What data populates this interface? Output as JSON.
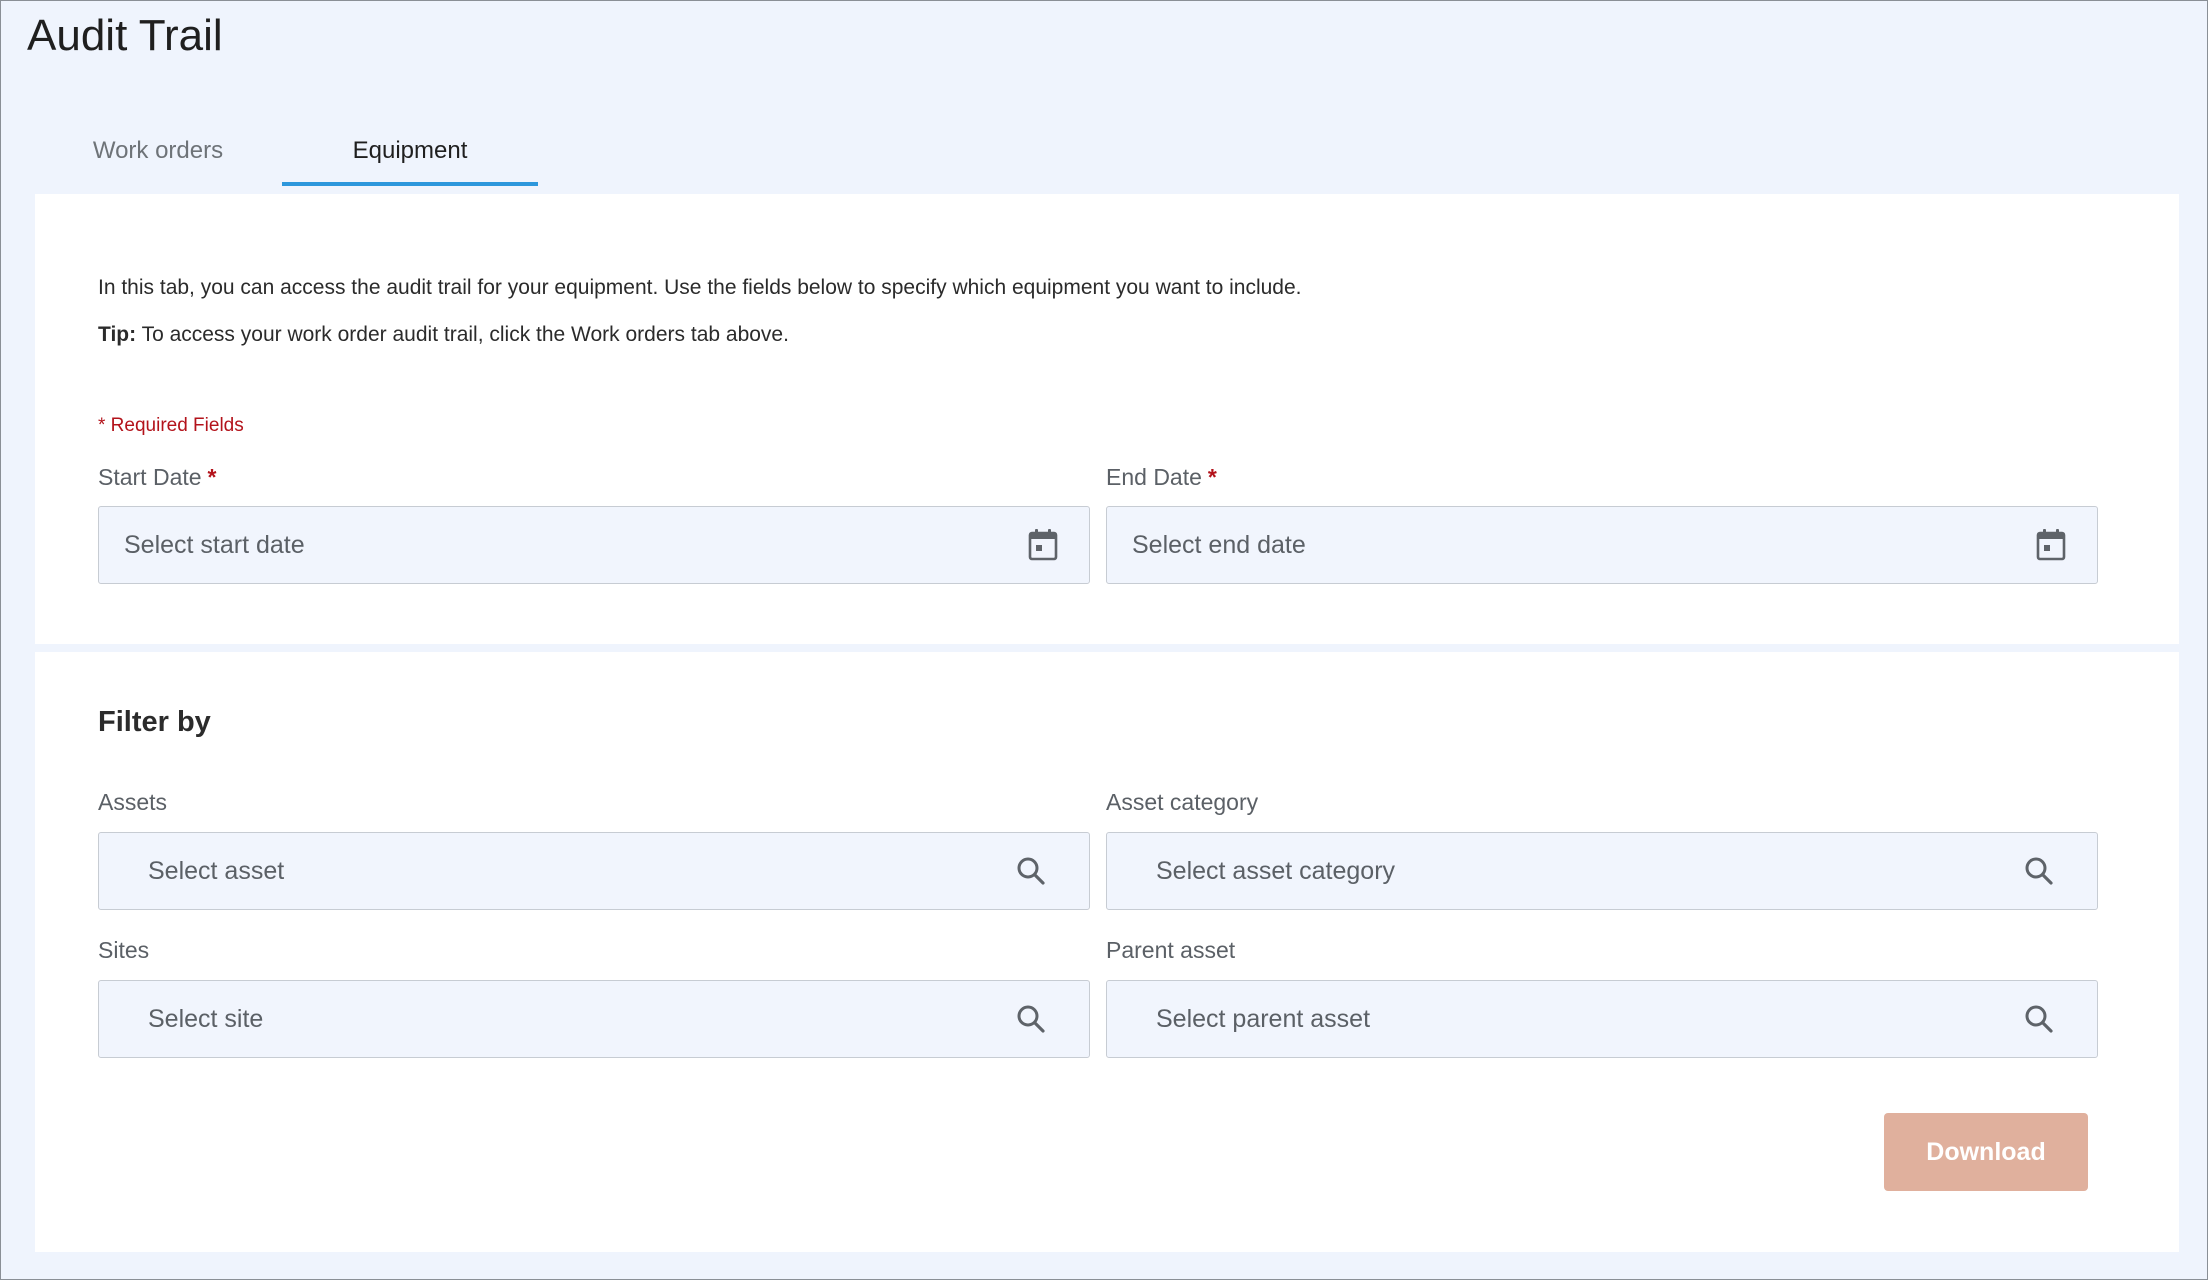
{
  "page": {
    "title": "Audit Trail"
  },
  "tabs": [
    {
      "label": "Work orders",
      "active": false
    },
    {
      "label": "Equipment",
      "active": true
    }
  ],
  "intro": {
    "description": "In this tab, you can access the audit trail for your equipment. Use the fields below to specify which equipment you want to include.",
    "tip_label": "Tip:",
    "tip_text": " To access your work order audit trail, click the Work orders tab above."
  },
  "form": {
    "required_note": "* Required Fields",
    "required_marker": "*",
    "start_date": {
      "label": "Start Date",
      "placeholder": "Select start date",
      "icon": "calendar-icon"
    },
    "end_date": {
      "label": "End Date",
      "placeholder": "Select end date",
      "icon": "calendar-icon"
    }
  },
  "filters": {
    "title": "Filter by",
    "assets": {
      "label": "Assets",
      "placeholder": "Select asset",
      "icon": "search-icon"
    },
    "asset_category": {
      "label": "Asset category",
      "placeholder": "Select asset category",
      "icon": "search-icon"
    },
    "sites": {
      "label": "Sites",
      "placeholder": "Select site",
      "icon": "search-icon"
    },
    "parent_asset": {
      "label": "Parent asset",
      "placeholder": "Select parent asset",
      "icon": "search-icon"
    }
  },
  "actions": {
    "download_label": "Download",
    "download_enabled": false
  },
  "colors": {
    "page_background": "#eff4fd",
    "accent_tab_underline": "#2d97dc",
    "required_red": "#b3131b",
    "download_button_disabled": "#e0b09d",
    "field_background": "#f1f5fd"
  }
}
